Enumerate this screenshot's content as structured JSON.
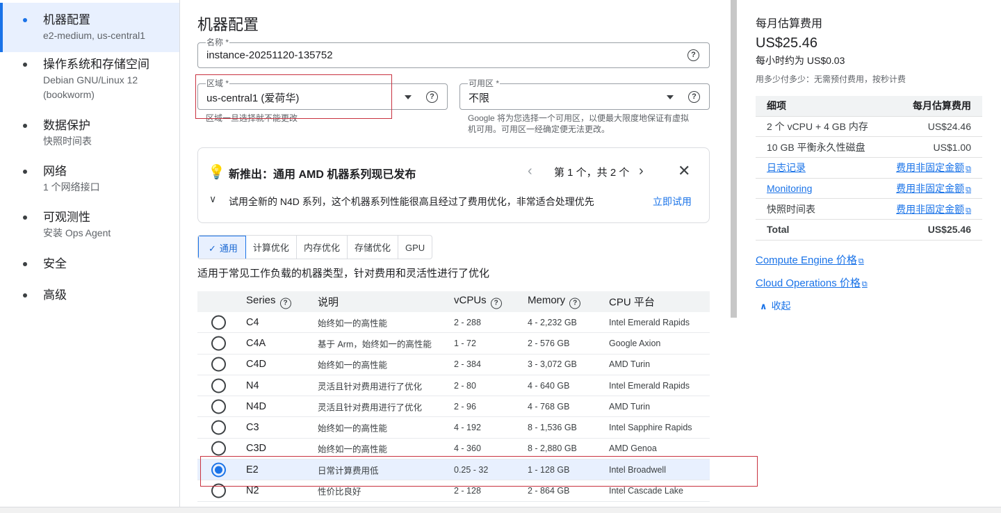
{
  "sidebar": {
    "items": [
      {
        "label": "机器配置",
        "sub": "e2-medium, us-central1"
      },
      {
        "label": "操作系统和存储空间",
        "sub": "Debian GNU/Linux 12 (bookworm)"
      },
      {
        "label": "数据保护",
        "sub": "快照时间表"
      },
      {
        "label": "网络",
        "sub": "1 个网络接口"
      },
      {
        "label": "可观测性",
        "sub": "安装 Ops Agent"
      },
      {
        "label": "安全",
        "sub": ""
      },
      {
        "label": "高级",
        "sub": ""
      }
    ]
  },
  "main": {
    "title": "机器配置",
    "name_field": {
      "label": "名称 *",
      "value": "instance-20251120-135752"
    },
    "region_field": {
      "label": "区域 *",
      "value": "us-central1 (爱荷华)",
      "hint": "区域一旦选择就不能更改"
    },
    "zone_field": {
      "label": "可用区 *",
      "value": "不限",
      "hint": "Google 将为您选择一个可用区，以便最大限度地保证有虚拟机可用。可用区一经确定便无法更改。"
    },
    "banner": {
      "title": "新推出：通用 AMD 机器系列现已发布",
      "pager": "第 1 个，共 2 个",
      "description": "试用全新的 N4D 系列，这个机器系列性能很高且经过了费用优化，非常适合处理优先",
      "try_label": "立即试用"
    },
    "tabs": [
      "通用",
      "计算优化",
      "内存优化",
      "存储优化",
      "GPU"
    ],
    "tab_description": "适用于常见工作负载的机器类型，针对费用和灵活性进行了优化",
    "table": {
      "headers": {
        "series": "Series",
        "description": "说明",
        "vcpus": "vCPUs",
        "memory": "Memory",
        "platform": "CPU 平台"
      },
      "rows": [
        {
          "series": "C4",
          "description": "始终如一的高性能",
          "vcpus": "2 - 288",
          "memory": "4 - 2,232 GB",
          "platform": "Intel Emerald Rapids"
        },
        {
          "series": "C4A",
          "description": "基于 Arm，始终如一的高性能",
          "vcpus": "1 - 72",
          "memory": "2 - 576 GB",
          "platform": "Google Axion"
        },
        {
          "series": "C4D",
          "description": "始终如一的高性能",
          "vcpus": "2 - 384",
          "memory": "3 - 3,072 GB",
          "platform": "AMD Turin"
        },
        {
          "series": "N4",
          "description": "灵活且针对费用进行了优化",
          "vcpus": "2 - 80",
          "memory": "4 - 640 GB",
          "platform": "Intel Emerald Rapids"
        },
        {
          "series": "N4D",
          "description": "灵活且针对费用进行了优化",
          "vcpus": "2 - 96",
          "memory": "4 - 768 GB",
          "platform": "AMD Turin"
        },
        {
          "series": "C3",
          "description": "始终如一的高性能",
          "vcpus": "4 - 192",
          "memory": "8 - 1,536 GB",
          "platform": "Intel Sapphire Rapids"
        },
        {
          "series": "C3D",
          "description": "始终如一的高性能",
          "vcpus": "4 - 360",
          "memory": "8 - 2,880 GB",
          "platform": "AMD Genoa"
        },
        {
          "series": "E2",
          "description": "日常计算费用低",
          "vcpus": "0.25 - 32",
          "memory": "1 - 128 GB",
          "platform": "Intel Broadwell",
          "selected": true
        },
        {
          "series": "N2",
          "description": "性价比良好",
          "vcpus": "2 - 128",
          "memory": "2 - 864 GB",
          "platform": "Intel Cascade Lake"
        }
      ]
    }
  },
  "cost": {
    "title": "每月估算费用",
    "amount": "US$25.46",
    "hourly": "每小时约为 US$0.03",
    "note": "用多少付多少：无需预付费用，按秒计费",
    "table": {
      "head_item": "细项",
      "head_cost": "每月估算费用",
      "rows": [
        {
          "item": "2 个 vCPU + 4 GB 内存",
          "cost": "US$24.46"
        },
        {
          "item": "10 GB 平衡永久性磁盘",
          "cost": "US$1.00"
        },
        {
          "item": "日志记录",
          "cost": "费用非固定金额"
        },
        {
          "item": "Monitoring",
          "cost": "费用非固定金额"
        },
        {
          "item": "快照时间表",
          "cost": "费用非固定金额"
        }
      ],
      "total_label": "Total",
      "total_value": "US$25.46"
    },
    "links": [
      "Compute Engine 价格",
      "Cloud Operations 价格"
    ],
    "collapse_label": "收起"
  },
  "colors": {
    "accent": "#1a73e8",
    "highlight_border": "#c8313f",
    "selected_row": "#e8f0fe"
  }
}
